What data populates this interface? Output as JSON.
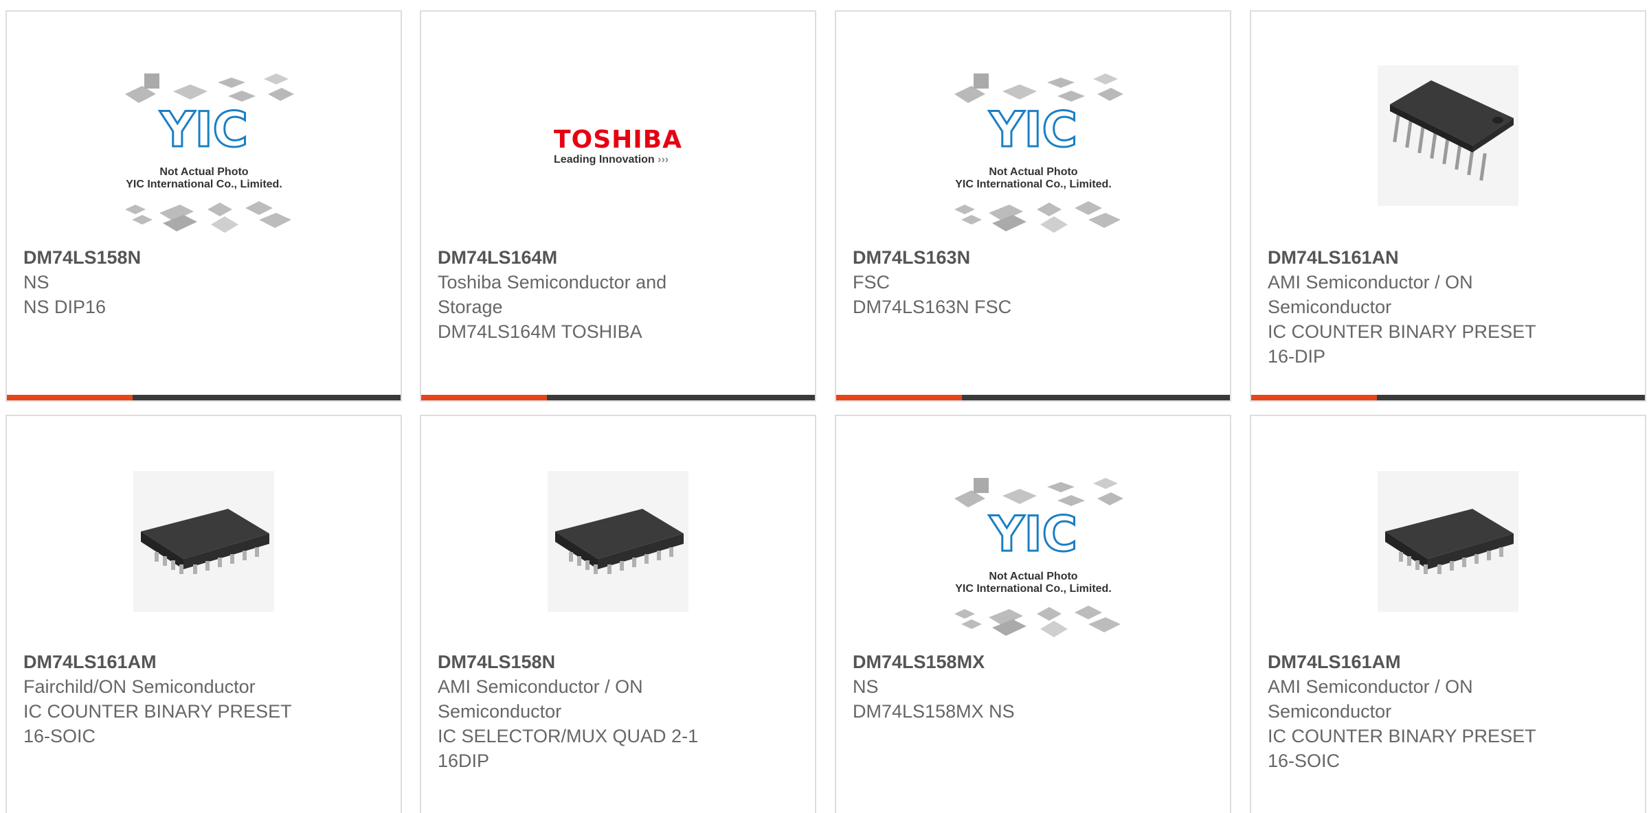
{
  "products": [
    {
      "part": "DM74LS158N",
      "maker": "NS",
      "desc": "NS DIP16",
      "image": "yic-placeholder"
    },
    {
      "part": "DM74LS164M",
      "maker": "Toshiba Semiconductor and Storage",
      "desc": "DM74LS164M TOSHIBA",
      "image": "toshiba-logo"
    },
    {
      "part": "DM74LS163N",
      "maker": "FSC",
      "desc": "DM74LS163N FSC",
      "image": "yic-placeholder"
    },
    {
      "part": "DM74LS161AN",
      "maker": "AMI Semiconductor / ON Semiconductor",
      "desc": "IC COUNTER BINARY PRESET 16-DIP",
      "image": "dip-chip"
    },
    {
      "part": "DM74LS161AM",
      "maker": "Fairchild/ON Semiconductor",
      "desc": "IC COUNTER BINARY PRESET 16-SOIC",
      "image": "soic-chip"
    },
    {
      "part": "DM74LS158N",
      "maker": "AMI Semiconductor / ON Semiconductor",
      "desc": "IC SELECTOR/MUX QUAD 2-1 16DIP",
      "image": "soic-chip"
    },
    {
      "part": "DM74LS158MX",
      "maker": "NS",
      "desc": "DM74LS158MX NS",
      "image": "yic-placeholder"
    },
    {
      "part": "DM74LS161AM",
      "maker": "AMI Semiconductor / ON Semiconductor",
      "desc": "IC COUNTER BINARY PRESET 16-SOIC",
      "image": "soic-chip"
    }
  ],
  "yic": {
    "logo": "YIC",
    "note1": "Not Actual Photo",
    "note2": "YIC International Co., Limited."
  },
  "toshiba": {
    "brand": "TOSHIBA",
    "tagline": "Leading Innovation"
  },
  "colors": {
    "accent": "#e8441a",
    "bar": "#3a3a3a",
    "toshiba": "#e60012",
    "yic_blue": "#1a7fc4"
  }
}
